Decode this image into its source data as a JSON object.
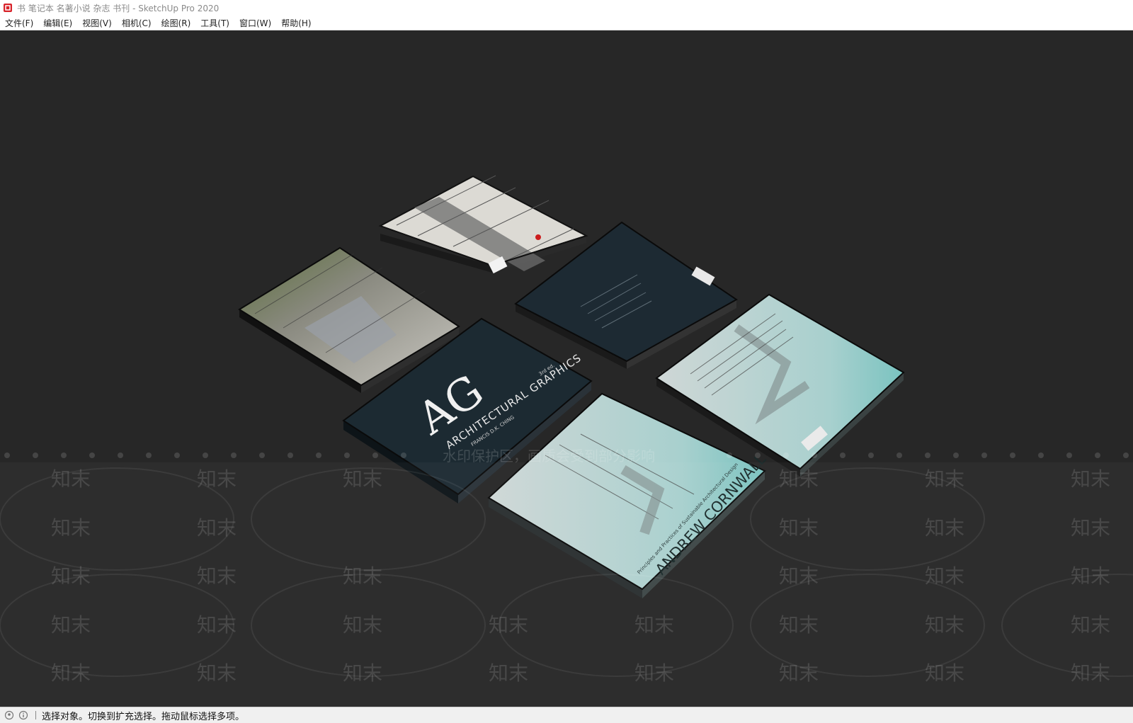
{
  "window": {
    "title": "书 笔记本 名著小说 杂志 书刊 - SketchUp Pro 2020"
  },
  "menu": {
    "file": "文件(F)",
    "edit": "编辑(E)",
    "view": "视图(V)",
    "camera": "相机(C)",
    "draw": "绘图(R)",
    "tools": "工具(T)",
    "window": "窗口(W)",
    "help": "帮助(H)"
  },
  "books": {
    "ag_logo": "AG",
    "ag_title": "ARCHITECTURAL GRAPHICS",
    "ag_edition": "3rd ed.",
    "ag_author": "FRANCIS D.K. CHING",
    "cornwall_author": "ANDREW CORNWALL",
    "cornwall_title": "Principles and Practices of Sustainable Architectural Design"
  },
  "watermark": {
    "brand": "知末",
    "notice": "水印保护区，画质会受到部分影响"
  },
  "status": {
    "message": "选择对象。切换到扩充选择。拖动鼠标选择多项。"
  }
}
